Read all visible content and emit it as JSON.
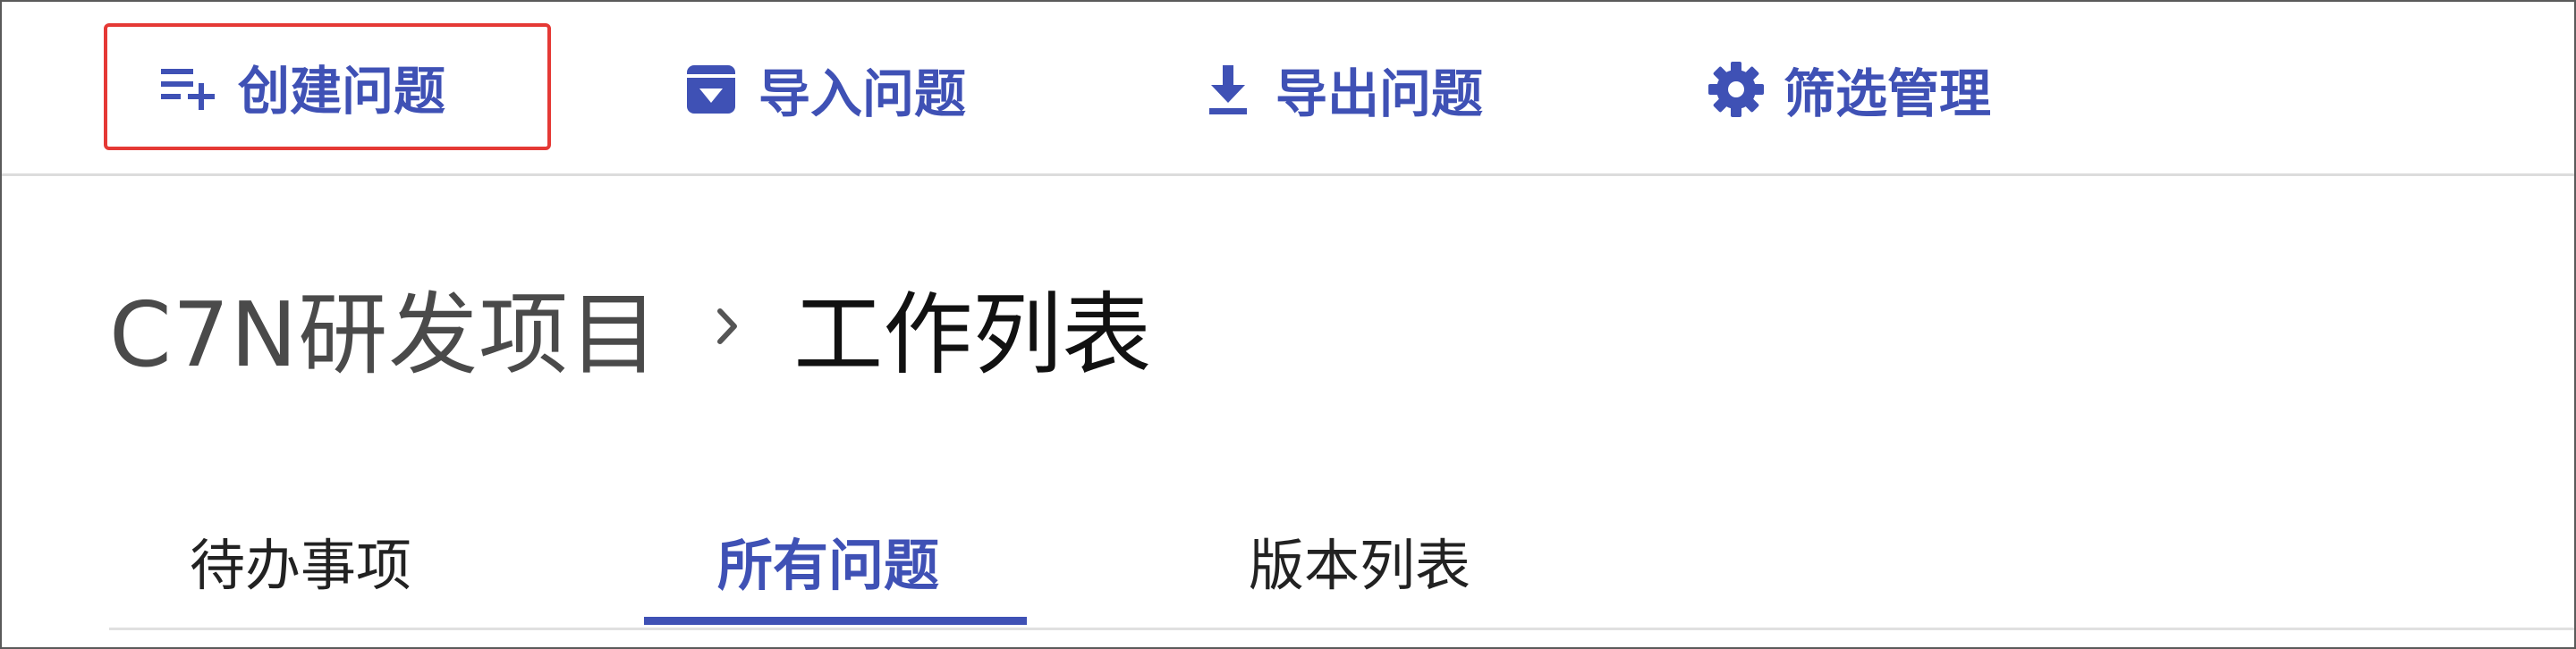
{
  "toolbar": {
    "create_label": "创建问题",
    "import_label": "导入问题",
    "export_label": "导出问题",
    "filter_label": "筛选管理",
    "accent_color": "#3f51b5",
    "highlight_color": "#e53935"
  },
  "breadcrumb": {
    "project": "C7N研发项目",
    "separator": "›",
    "current": "工作列表"
  },
  "tabs": [
    {
      "label": "待办事项",
      "active": false
    },
    {
      "label": "所有问题",
      "active": true
    },
    {
      "label": "版本列表",
      "active": false
    }
  ],
  "icons": {
    "create": "playlist-add-icon",
    "import": "archive-icon",
    "export": "download-icon",
    "filter": "gear-icon"
  }
}
